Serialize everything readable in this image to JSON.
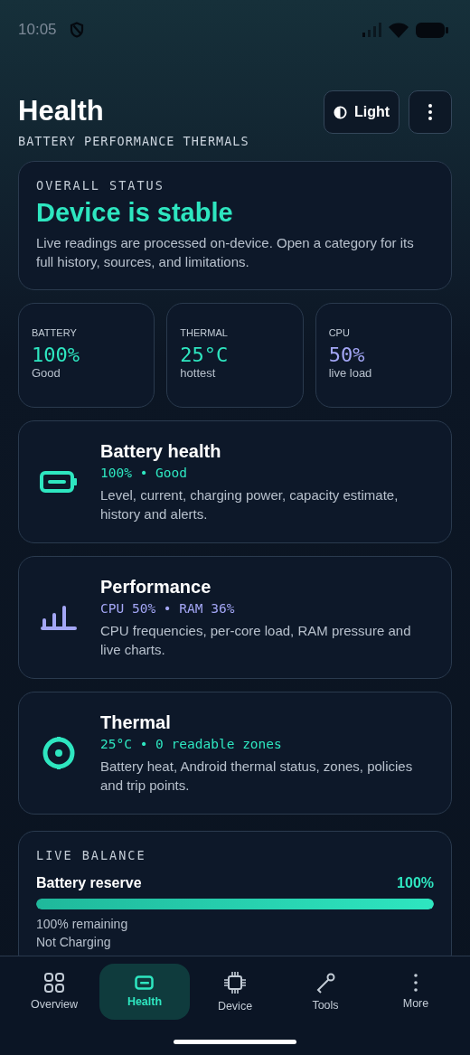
{
  "status_bar": {
    "time": "10:05"
  },
  "header": {
    "title": "Health",
    "subtitle": "BATTERY PERFORMANCE THERMALS",
    "theme_button": "Light"
  },
  "overall": {
    "label": "OVERALL STATUS",
    "headline": "Device is stable",
    "description": "Live readings are processed on-device. Open a category for its full history, sources, and limitations."
  },
  "stats": [
    {
      "label": "BATTERY",
      "value": "100%",
      "note": "Good",
      "color": "#2ee6c0"
    },
    {
      "label": "THERMAL",
      "value": "25°C",
      "note": "hottest",
      "color": "#2ee6c0"
    },
    {
      "label": "CPU",
      "value": "50%",
      "note": "live load",
      "color": "#a3a6f5"
    }
  ],
  "categories": [
    {
      "kind": "battery",
      "title": "Battery health",
      "summary": "100% • Good",
      "color": "#2ee6c0",
      "description": "Level, current, charging power, capacity estimate, history and alerts."
    },
    {
      "kind": "performance",
      "title": "Performance",
      "summary": "CPU 50% • RAM 36%",
      "color": "#a3a6f5",
      "description": "CPU frequencies, per-core load, RAM pressure and live charts."
    },
    {
      "kind": "thermal",
      "title": "Thermal",
      "summary": "25°C • 0 readable zones",
      "color": "#2ee6c0",
      "description": "Battery heat, Android thermal status, zones, policies and trip points."
    }
  ],
  "live_balance": {
    "label": "LIVE BALANCE",
    "title": "Battery reserve",
    "reading": "100%",
    "level": 1,
    "remaining": "100% remaining",
    "status": "Not Charging"
  },
  "nav": [
    {
      "kind": "overview",
      "label": "Overview",
      "selected": false
    },
    {
      "kind": "health",
      "label": "Health",
      "selected": true
    },
    {
      "kind": "device",
      "label": "Device",
      "selected": false
    },
    {
      "kind": "tools",
      "label": "Tools",
      "selected": false
    },
    {
      "kind": "more",
      "label": "More",
      "selected": false
    }
  ]
}
